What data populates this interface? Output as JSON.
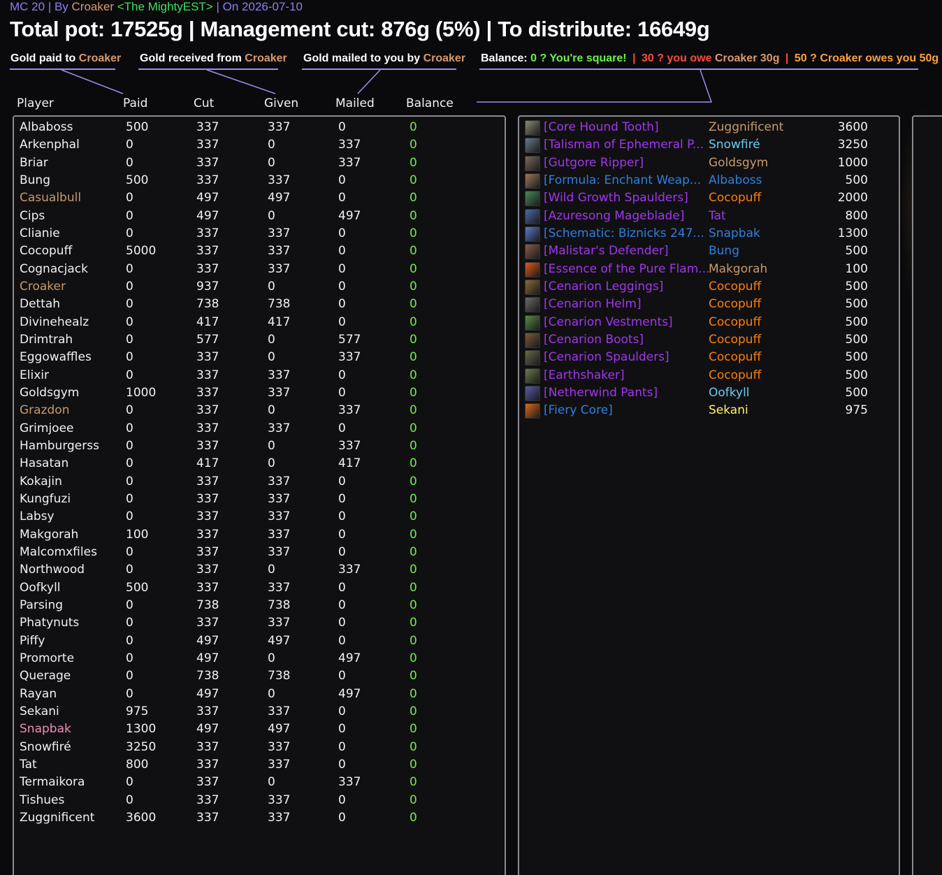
{
  "header": {
    "raid": "MC 20",
    "by_label": "By",
    "author": "Croaker",
    "guild": "<The MightyEST>",
    "on_label": "On",
    "date": "2026-07-10"
  },
  "title": "Total pot: 17525g | Management cut: 876g (5%) | To distribute: 16649g",
  "legend": {
    "paid_prefix": "Gold paid to",
    "paid_name": "Croaker",
    "received_prefix": "Gold received from",
    "received_name": "Croaker",
    "mailed_prefix": "Gold mailed to you by",
    "mailed_name": "Croaker",
    "balance_label": "Balance:",
    "square_text": "0 ? You're square!",
    "owe_text": "30 ? you owe",
    "owe_name": "Croaker",
    "owe_amount": "30g",
    "owed_text": "50 ? Croaker owes you 50g",
    "separator": "|"
  },
  "columns": [
    "Player",
    "Paid",
    "Cut",
    "Given",
    "Mailed",
    "Balance"
  ],
  "colors": {
    "player_default": "#f2f2f2",
    "player_croaker": "#c89a6a",
    "player_pink": "#f08cb8",
    "balance": "#6cf04a",
    "accent": "#9b8ff0"
  },
  "players": [
    {
      "name": "Albaboss",
      "paid": "500",
      "cut": "337",
      "given": "337",
      "mailed": "0",
      "balance": "0",
      "color": "#f2f2f2"
    },
    {
      "name": "Arkenphal",
      "paid": "0",
      "cut": "337",
      "given": "0",
      "mailed": "337",
      "balance": "0",
      "color": "#f2f2f2"
    },
    {
      "name": "Briar",
      "paid": "0",
      "cut": "337",
      "given": "0",
      "mailed": "337",
      "balance": "0",
      "color": "#f2f2f2"
    },
    {
      "name": "Bung",
      "paid": "500",
      "cut": "337",
      "given": "337",
      "mailed": "0",
      "balance": "0",
      "color": "#f2f2f2"
    },
    {
      "name": "Casualbull",
      "paid": "0",
      "cut": "497",
      "given": "497",
      "mailed": "0",
      "balance": "0",
      "color": "#c89a6a"
    },
    {
      "name": "Cips",
      "paid": "0",
      "cut": "497",
      "given": "0",
      "mailed": "497",
      "balance": "0",
      "color": "#f2f2f2"
    },
    {
      "name": "Clianie",
      "paid": "0",
      "cut": "337",
      "given": "337",
      "mailed": "0",
      "balance": "0",
      "color": "#f2f2f2"
    },
    {
      "name": "Cocopuff",
      "paid": "5000",
      "cut": "337",
      "given": "337",
      "mailed": "0",
      "balance": "0",
      "color": "#f2f2f2"
    },
    {
      "name": "Cognacjack",
      "paid": "0",
      "cut": "337",
      "given": "337",
      "mailed": "0",
      "balance": "0",
      "color": "#f2f2f2"
    },
    {
      "name": "Croaker",
      "paid": "0",
      "cut": "937",
      "given": "0",
      "mailed": "0",
      "balance": "0",
      "color": "#c89a6a"
    },
    {
      "name": "Dettah",
      "paid": "0",
      "cut": "738",
      "given": "738",
      "mailed": "0",
      "balance": "0",
      "color": "#f2f2f2"
    },
    {
      "name": "Divinehealz",
      "paid": "0",
      "cut": "417",
      "given": "417",
      "mailed": "0",
      "balance": "0",
      "color": "#f2f2f2"
    },
    {
      "name": "Drimtrah",
      "paid": "0",
      "cut": "577",
      "given": "0",
      "mailed": "577",
      "balance": "0",
      "color": "#f2f2f2"
    },
    {
      "name": "Eggowaffles",
      "paid": "0",
      "cut": "337",
      "given": "0",
      "mailed": "337",
      "balance": "0",
      "color": "#f2f2f2"
    },
    {
      "name": "Elixir",
      "paid": "0",
      "cut": "337",
      "given": "337",
      "mailed": "0",
      "balance": "0",
      "color": "#f2f2f2"
    },
    {
      "name": "Goldsgym",
      "paid": "1000",
      "cut": "337",
      "given": "337",
      "mailed": "0",
      "balance": "0",
      "color": "#f2f2f2"
    },
    {
      "name": "Grazdon",
      "paid": "0",
      "cut": "337",
      "given": "0",
      "mailed": "337",
      "balance": "0",
      "color": "#c89a6a"
    },
    {
      "name": "Grimjoee",
      "paid": "0",
      "cut": "337",
      "given": "337",
      "mailed": "0",
      "balance": "0",
      "color": "#f2f2f2"
    },
    {
      "name": "Hamburgerss",
      "paid": "0",
      "cut": "337",
      "given": "0",
      "mailed": "337",
      "balance": "0",
      "color": "#f2f2f2"
    },
    {
      "name": "Hasatan",
      "paid": "0",
      "cut": "417",
      "given": "0",
      "mailed": "417",
      "balance": "0",
      "color": "#f2f2f2"
    },
    {
      "name": "Kokajin",
      "paid": "0",
      "cut": "337",
      "given": "337",
      "mailed": "0",
      "balance": "0",
      "color": "#f2f2f2"
    },
    {
      "name": "Kungfuzi",
      "paid": "0",
      "cut": "337",
      "given": "337",
      "mailed": "0",
      "balance": "0",
      "color": "#f2f2f2"
    },
    {
      "name": "Labsy",
      "paid": "0",
      "cut": "337",
      "given": "337",
      "mailed": "0",
      "balance": "0",
      "color": "#f2f2f2"
    },
    {
      "name": "Makgorah",
      "paid": "100",
      "cut": "337",
      "given": "337",
      "mailed": "0",
      "balance": "0",
      "color": "#f2f2f2"
    },
    {
      "name": "Malcomxfiles",
      "paid": "0",
      "cut": "337",
      "given": "337",
      "mailed": "0",
      "balance": "0",
      "color": "#f2f2f2"
    },
    {
      "name": "Northwood",
      "paid": "0",
      "cut": "337",
      "given": "0",
      "mailed": "337",
      "balance": "0",
      "color": "#f2f2f2"
    },
    {
      "name": "Oofkyll",
      "paid": "500",
      "cut": "337",
      "given": "337",
      "mailed": "0",
      "balance": "0",
      "color": "#f2f2f2"
    },
    {
      "name": "Parsing",
      "paid": "0",
      "cut": "738",
      "given": "738",
      "mailed": "0",
      "balance": "0",
      "color": "#f2f2f2"
    },
    {
      "name": "Phatynuts",
      "paid": "0",
      "cut": "337",
      "given": "337",
      "mailed": "0",
      "balance": "0",
      "color": "#f2f2f2"
    },
    {
      "name": "Piffy",
      "paid": "0",
      "cut": "497",
      "given": "497",
      "mailed": "0",
      "balance": "0",
      "color": "#f2f2f2"
    },
    {
      "name": "Promorte",
      "paid": "0",
      "cut": "497",
      "given": "0",
      "mailed": "497",
      "balance": "0",
      "color": "#f2f2f2"
    },
    {
      "name": "Querage",
      "paid": "0",
      "cut": "738",
      "given": "738",
      "mailed": "0",
      "balance": "0",
      "color": "#f2f2f2"
    },
    {
      "name": "Rayan",
      "paid": "0",
      "cut": "497",
      "given": "0",
      "mailed": "497",
      "balance": "0",
      "color": "#f2f2f2"
    },
    {
      "name": "Sekani",
      "paid": "975",
      "cut": "337",
      "given": "337",
      "mailed": "0",
      "balance": "0",
      "color": "#f2f2f2"
    },
    {
      "name": "Snapbak",
      "paid": "1300",
      "cut": "497",
      "given": "497",
      "mailed": "0",
      "balance": "0",
      "color": "#f08cb8"
    },
    {
      "name": "Snowfiré",
      "paid": "3250",
      "cut": "337",
      "given": "337",
      "mailed": "0",
      "balance": "0",
      "color": "#f2f2f2"
    },
    {
      "name": "Tat",
      "paid": "800",
      "cut": "337",
      "given": "337",
      "mailed": "0",
      "balance": "0",
      "color": "#f2f2f2"
    },
    {
      "name": "Termaikora",
      "paid": "0",
      "cut": "337",
      "given": "0",
      "mailed": "337",
      "balance": "0",
      "color": "#f2f2f2"
    },
    {
      "name": "Tishues",
      "paid": "0",
      "cut": "337",
      "given": "337",
      "mailed": "0",
      "balance": "0",
      "color": "#f2f2f2"
    },
    {
      "name": "Zuggnificent",
      "paid": "3600",
      "cut": "337",
      "given": "337",
      "mailed": "0",
      "balance": "0",
      "color": "#f2f2f2"
    }
  ],
  "loot": [
    {
      "item": "[Core Hound Tooth]",
      "buyer": "Zuggnificent",
      "price": "3600",
      "item_color": "#a335ee",
      "buyer_color": "#c89a6a",
      "icon": "tooth-icon",
      "icon_color": "#8a8a7a"
    },
    {
      "item": "[Talisman of Ephemeral P...",
      "buyer": "Snowfiré",
      "price": "3250",
      "item_color": "#a335ee",
      "buyer_color": "#69ccf0",
      "icon": "talisman-icon",
      "icon_color": "#6a7a8a"
    },
    {
      "item": "[Gutgore Ripper]",
      "buyer": "Goldsgym",
      "price": "1000",
      "item_color": "#a335ee",
      "buyer_color": "#c89a6a",
      "icon": "dagger-icon",
      "icon_color": "#7a6a5a"
    },
    {
      "item": "[Formula: Enchant Weap...",
      "buyer": "Albaboss",
      "price": "500",
      "item_color": "#2f7fe0",
      "buyer_color": "#2f7fe0",
      "icon": "scroll-icon",
      "icon_color": "#9a7a5a"
    },
    {
      "item": "[Wild Growth Spaulders]",
      "buyer": "Cocopuff",
      "price": "2000",
      "item_color": "#a335ee",
      "buyer_color": "#ff7d0a",
      "icon": "shoulder-icon",
      "icon_color": "#4a8a5a"
    },
    {
      "item": "[Azuresong Mageblade]",
      "buyer": "Tat",
      "price": "800",
      "item_color": "#a335ee",
      "buyer_color": "#a335ee",
      "icon": "sword-icon",
      "icon_color": "#4a6aaa"
    },
    {
      "item": "[Schematic: Biznicks 247...",
      "buyer": "Snapbak",
      "price": "1300",
      "item_color": "#2f7fe0",
      "buyer_color": "#2f7fe0",
      "icon": "schematic-icon",
      "icon_color": "#5a7aca"
    },
    {
      "item": "[Malistar's Defender]",
      "buyer": "Bung",
      "price": "500",
      "item_color": "#a335ee",
      "buyer_color": "#2f7fe0",
      "icon": "shield-icon",
      "icon_color": "#8a5a4a"
    },
    {
      "item": "[Essence of the Pure Flam...",
      "buyer": "Makgorah",
      "price": "100",
      "item_color": "#a335ee",
      "buyer_color": "#c89a6a",
      "icon": "flame-icon",
      "icon_color": "#e05a1a"
    },
    {
      "item": "[Cenarion Leggings]",
      "buyer": "Cocopuff",
      "price": "500",
      "item_color": "#a335ee",
      "buyer_color": "#ff7d0a",
      "icon": "leggings-icon",
      "icon_color": "#8a6a3a"
    },
    {
      "item": "[Cenarion Helm]",
      "buyer": "Cocopuff",
      "price": "500",
      "item_color": "#a335ee",
      "buyer_color": "#ff7d0a",
      "icon": "helm-icon",
      "icon_color": "#6a6a6a"
    },
    {
      "item": "[Cenarion Vestments]",
      "buyer": "Cocopuff",
      "price": "500",
      "item_color": "#a335ee",
      "buyer_color": "#ff7d0a",
      "icon": "chest-icon",
      "icon_color": "#5a8a4a"
    },
    {
      "item": "[Cenarion Boots]",
      "buyer": "Cocopuff",
      "price": "500",
      "item_color": "#a335ee",
      "buyer_color": "#ff7d0a",
      "icon": "boots-icon",
      "icon_color": "#7a5a3a"
    },
    {
      "item": "[Cenarion Spaulders]",
      "buyer": "Cocopuff",
      "price": "500",
      "item_color": "#a335ee",
      "buyer_color": "#ff7d0a",
      "icon": "shoulder-icon",
      "icon_color": "#6a6a4a"
    },
    {
      "item": "[Earthshaker]",
      "buyer": "Cocopuff",
      "price": "500",
      "item_color": "#a335ee",
      "buyer_color": "#ff7d0a",
      "icon": "mace-icon",
      "icon_color": "#6a7a4a"
    },
    {
      "item": "[Netherwind Pants]",
      "buyer": "Oofkyll",
      "price": "500",
      "item_color": "#a335ee",
      "buyer_color": "#69ccf0",
      "icon": "pants-icon",
      "icon_color": "#5a5aaa"
    },
    {
      "item": "[Fiery Core]",
      "buyer": "Sekani",
      "price": "975",
      "item_color": "#2f7fe0",
      "buyer_color": "#fff569",
      "icon": "fire-icon",
      "icon_color": "#e06a1a"
    }
  ]
}
